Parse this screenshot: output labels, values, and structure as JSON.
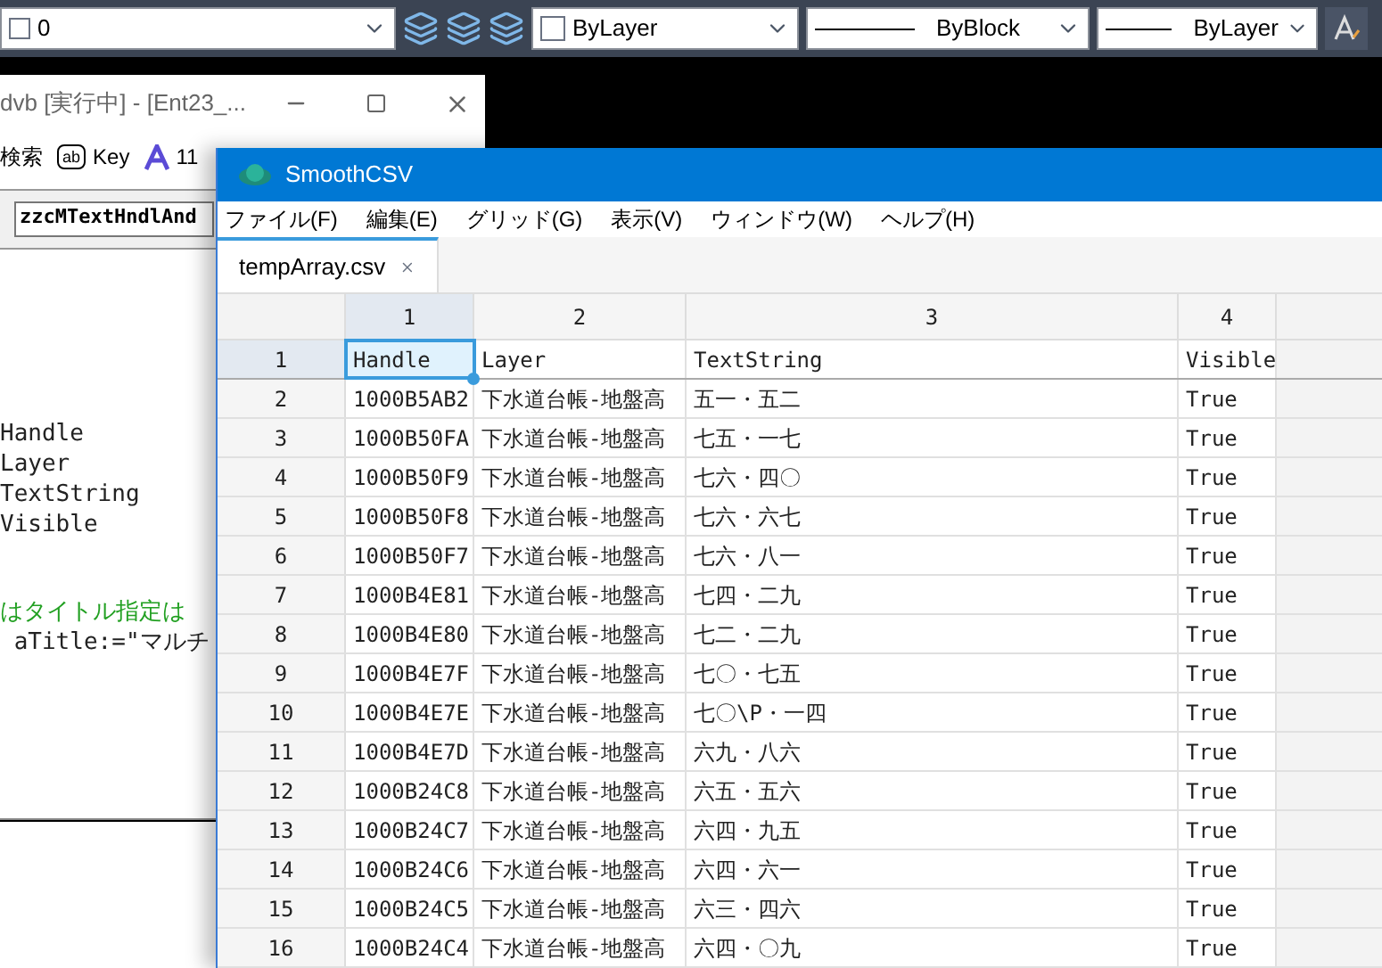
{
  "toolbar": {
    "layer": {
      "value": "0"
    },
    "color": {
      "value": "ByLayer"
    },
    "linetype": {
      "value": "ByBlock"
    },
    "lineweight": {
      "value": "ByLayer"
    }
  },
  "back_window": {
    "title": "dvb [実行中] - [Ent23_...",
    "toolbar": [
      {
        "kind": "text",
        "label": "検索"
      },
      {
        "kind": "ab",
        "label": "Key"
      },
      {
        "kind": "font",
        "label": "11"
      }
    ],
    "field": {
      "value": "zzcMTextHndlAnd"
    },
    "code_lines": [
      {
        "kind": "code",
        "text": "Handle"
      },
      {
        "kind": "code",
        "text": "Layer"
      },
      {
        "kind": "code",
        "text": "TextString"
      },
      {
        "kind": "code",
        "text": "Visible"
      },
      {
        "kind": "comment",
        "text": "はタイトル指定は"
      },
      {
        "kind": "code",
        "text": " aTitle:=\"マルチ"
      }
    ]
  },
  "csv_window": {
    "title": "SmoothCSV",
    "menus": [
      "ファイル(F)",
      "編集(E)",
      "グリッド(G)",
      "表示(V)",
      "ウィンドウ(W)",
      "ヘルプ(H)"
    ],
    "tabs": [
      {
        "label": "tempArray.csv",
        "selected": true
      }
    ],
    "columns": [
      {
        "label": "1",
        "selected": true
      },
      {
        "label": "2",
        "selected": false
      },
      {
        "label": "3",
        "selected": false
      },
      {
        "label": "4",
        "selected": false
      }
    ],
    "rows": [
      {
        "number": "1",
        "selected": true,
        "cells": [
          "Handle",
          "Layer",
          "TextString",
          "Visible"
        ]
      },
      {
        "number": "2",
        "selected": false,
        "cells": [
          "1000B5AB2",
          "下水道台帳-地盤高",
          "五一・五二",
          "True"
        ]
      },
      {
        "number": "3",
        "selected": false,
        "cells": [
          "1000B50FA",
          "下水道台帳-地盤高",
          "七五・一七",
          "True"
        ]
      },
      {
        "number": "4",
        "selected": false,
        "cells": [
          "1000B50F9",
          "下水道台帳-地盤高",
          "七六・四〇",
          "True"
        ]
      },
      {
        "number": "5",
        "selected": false,
        "cells": [
          "1000B50F8",
          "下水道台帳-地盤高",
          "七六・六七",
          "True"
        ]
      },
      {
        "number": "6",
        "selected": false,
        "cells": [
          "1000B50F7",
          "下水道台帳-地盤高",
          "七六・八一",
          "True"
        ]
      },
      {
        "number": "7",
        "selected": false,
        "cells": [
          "1000B4E81",
          "下水道台帳-地盤高",
          "七四・二九",
          "True"
        ]
      },
      {
        "number": "8",
        "selected": false,
        "cells": [
          "1000B4E80",
          "下水道台帳-地盤高",
          "七二・二九",
          "True"
        ]
      },
      {
        "number": "9",
        "selected": false,
        "cells": [
          "1000B4E7F",
          "下水道台帳-地盤高",
          "七〇・七五",
          "True"
        ]
      },
      {
        "number": "10",
        "selected": false,
        "cells": [
          "1000B4E7E",
          "下水道台帳-地盤高",
          "七〇\\P・一四",
          "True"
        ]
      },
      {
        "number": "11",
        "selected": false,
        "cells": [
          "1000B4E7D",
          "下水道台帳-地盤高",
          "六九・八六",
          "True"
        ]
      },
      {
        "number": "12",
        "selected": false,
        "cells": [
          "1000B24C8",
          "下水道台帳-地盤高",
          "六五・五六",
          "True"
        ]
      },
      {
        "number": "13",
        "selected": false,
        "cells": [
          "1000B24C7",
          "下水道台帳-地盤高",
          "六四・九五",
          "True"
        ]
      },
      {
        "number": "14",
        "selected": false,
        "cells": [
          "1000B24C6",
          "下水道台帳-地盤高",
          "六四・六一",
          "True"
        ]
      },
      {
        "number": "15",
        "selected": false,
        "cells": [
          "1000B24C5",
          "下水道台帳-地盤高",
          "六三・四六",
          "True"
        ]
      },
      {
        "number": "16",
        "selected": false,
        "cells": [
          "1000B24C4",
          "下水道台帳-地盤高",
          "六四・〇九",
          "True"
        ]
      }
    ]
  }
}
